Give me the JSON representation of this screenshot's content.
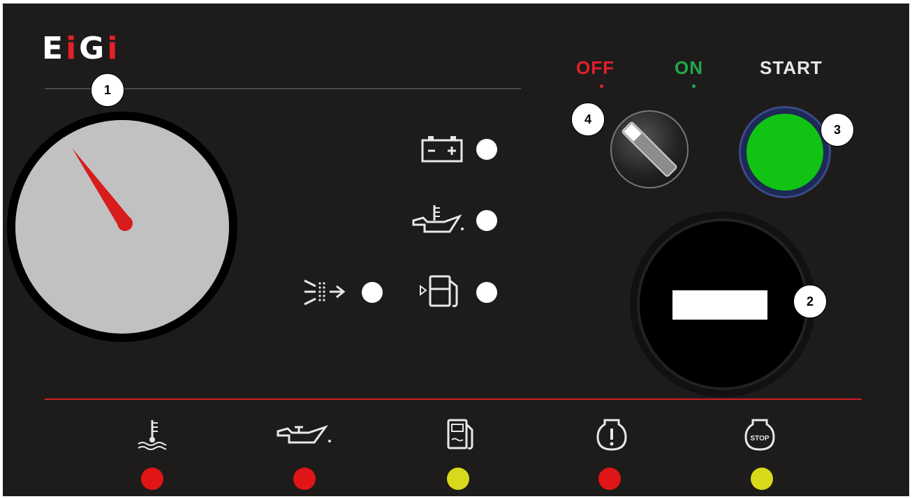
{
  "brand": {
    "logo_text_a": "E",
    "logo_text_b": "i",
    "logo_text_c": "G",
    "logo_text_d": "i",
    "accent": "#e2202a"
  },
  "switch_labels": {
    "off": "OFF",
    "on": "ON",
    "start": "START",
    "off_color": "#e2202a",
    "on_color": "#1fa84a",
    "start_color": "#e8e8e8"
  },
  "callouts": {
    "gauge": "1",
    "hour_meter": "2",
    "start_button": "3",
    "key_switch": "4"
  },
  "indicator_icons": {
    "battery": "battery-icon",
    "oil_level": "oil-temperature-icon",
    "air_filter": "air-filter-icon",
    "fuel_level": "fuel-pump-icon"
  },
  "warning_lamps": [
    {
      "icon": "coolant-temperature-icon",
      "color": "#e01515"
    },
    {
      "icon": "oil-pressure-icon",
      "color": "#e01515"
    },
    {
      "icon": "fuel-icon",
      "color": "#d9d91c"
    },
    {
      "icon": "engine-fault-icon",
      "color": "#e01515"
    },
    {
      "icon": "engine-stop-icon",
      "color": "#d9d91c"
    }
  ],
  "stop_icon_text": "STOP",
  "start_button_color": "#11c414"
}
